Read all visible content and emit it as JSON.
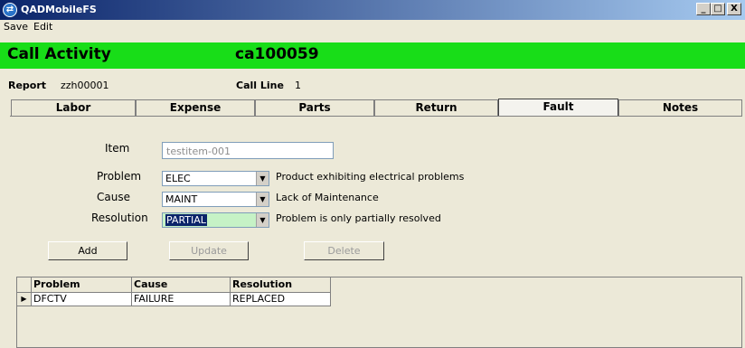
{
  "window": {
    "title": "QADMobileFS",
    "minimize": "_",
    "maximize": "□",
    "close": "X"
  },
  "menu": {
    "items": [
      "Save",
      "Edit"
    ]
  },
  "header": {
    "title": "Call Activity",
    "id": "ca100059",
    "color": "#18dd18"
  },
  "info": {
    "report_label": "Report",
    "report_value": "zzh00001",
    "call_line_label": "Call Line",
    "call_line_value": "1"
  },
  "tabs": [
    "Labor",
    "Expense",
    "Parts",
    "Return",
    "Fault",
    "Notes"
  ],
  "active_tab": "Fault",
  "form": {
    "item_label": "Item",
    "item_value": "testitem-001",
    "problem_label": "Problem",
    "problem_value": "ELEC",
    "problem_desc": "Product exhibiting electrical problems",
    "cause_label": "Cause",
    "cause_value": "MAINT",
    "cause_desc": "Lack of Maintenance",
    "resolution_label": "Resolution",
    "resolution_value": "PARTIAL",
    "resolution_desc": "Problem is only partially resolved"
  },
  "buttons": {
    "add": "Add",
    "update": "Update",
    "delete": "Delete"
  },
  "grid": {
    "columns": [
      "Problem",
      "Cause",
      "Resolution"
    ],
    "rows": [
      [
        "DFCTV",
        "FAILURE",
        "REPLACED"
      ]
    ]
  }
}
